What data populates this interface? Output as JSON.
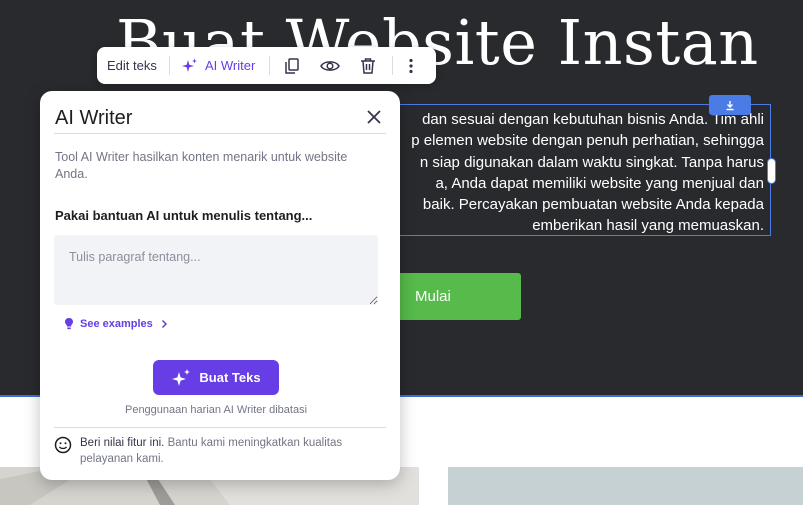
{
  "hero": {
    "title": "Buat Website Instan",
    "paragraph": "dan sesuai dengan kebutuhan bisnis Anda. Tim ahli\np elemen website dengan penuh perhatian, sehingga\nn siap digunakan dalam waktu singkat. Tanpa harus\na, Anda dapat memiliki website yang menjual dan\nbaik. Percayakan pembuatan website Anda kepada\nemberikan hasil yang memuaskan.",
    "cta_label": "Mulai"
  },
  "toolbar": {
    "edit_label": "Edit teks",
    "ai_label": "AI Writer"
  },
  "panel": {
    "title": "AI Writer",
    "description": "Tool AI Writer hasilkan konten menarik untuk website Anda.",
    "prompt_label": "Pakai bantuan AI untuk menulis tentang...",
    "textarea_placeholder": "Tulis paragraf tentang...",
    "textarea_value": "",
    "examples_label": "See examples",
    "generate_label": "Buat Teks",
    "usage_note": "Penggunaan harian AI Writer dibatasi",
    "rating_title": "Beri nilai fitur ini.",
    "rating_sub": "Bantu kami meningkatkan kualitas pelayanan kami."
  },
  "colors": {
    "accent": "#673de6",
    "hero_bg": "#282a2d",
    "cta": "#56bb4a",
    "selection": "#4b7be5"
  }
}
